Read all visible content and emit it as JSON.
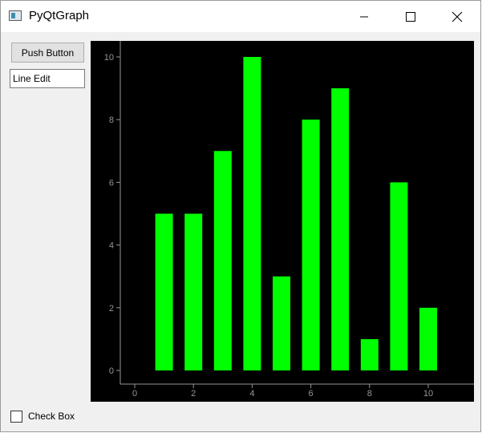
{
  "window": {
    "title": "PyQtGraph",
    "icon": "pyqtgraph-app-icon",
    "controls": [
      "minimize-icon",
      "maximize-icon",
      "close-icon"
    ]
  },
  "controls": {
    "push_button_label": "Push Button",
    "line_edit_value": "Line Edit",
    "checkbox_label": "Check Box",
    "checkbox_checked": false
  },
  "colors": {
    "bar": "#00ff00",
    "plot_background": "#000000",
    "axis": "#969696"
  },
  "chart_data": {
    "type": "bar",
    "x": [
      1,
      2,
      3,
      4,
      5,
      6,
      7,
      8,
      9,
      10
    ],
    "values": [
      5,
      5,
      7,
      10,
      3,
      8,
      9,
      1,
      6,
      2
    ],
    "bar_width": 0.6,
    "xlim": [
      -0.5,
      11.5
    ],
    "ylim": [
      -0.5,
      10.5
    ],
    "x_ticks": [
      0,
      2,
      4,
      6,
      8,
      10
    ],
    "y_ticks": [
      0,
      2,
      4,
      6,
      8,
      10
    ],
    "title": "",
    "xlabel": "",
    "ylabel": "",
    "grid": false
  }
}
